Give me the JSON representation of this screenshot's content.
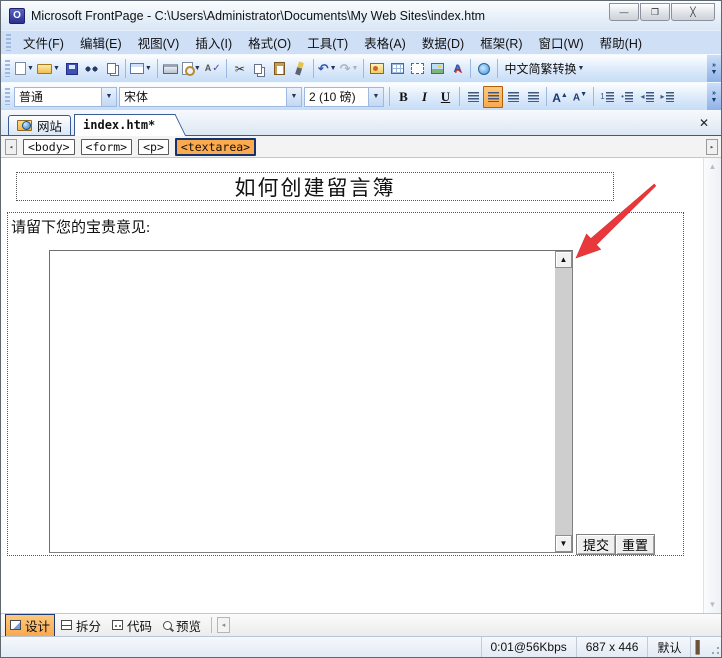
{
  "titlebar": {
    "title": "Microsoft FrontPage - C:\\Users\\Administrator\\Documents\\My Web Sites\\index.htm",
    "app_icon_letter": "O"
  },
  "window_controls": {
    "minimize": "—",
    "maximize": "❐",
    "close": "╳"
  },
  "menu": {
    "items": [
      "文件(F)",
      "编辑(E)",
      "视图(V)",
      "插入(I)",
      "格式(O)",
      "工具(T)",
      "表格(A)",
      "数据(D)",
      "框架(R)",
      "窗口(W)",
      "帮助(H)"
    ]
  },
  "toolbar_standard": {
    "icons": [
      "new-document",
      "open",
      "save",
      "find",
      "publish-site",
      "toggle-pane",
      "print",
      "print-preview",
      "spelling",
      "cut",
      "copy",
      "paste",
      "format-painter",
      "undo",
      "redo",
      "web-component",
      "insert-table",
      "insert-layer",
      "insert-picture",
      "insert-drawing",
      "hyperlink"
    ],
    "chinese_convert": "中文简繁转换",
    "spelling_glyph": "✓",
    "cut_glyph": "✂",
    "undo_glyph": "↶",
    "redo_glyph": "↷",
    "drawing_glyph": "A"
  },
  "formatting": {
    "style": "普通",
    "font": "宋体",
    "size": "2 (10 磅)",
    "bold": "B",
    "italic": "I",
    "underline": "U",
    "grow_font": "A",
    "shrink_font": "A",
    "active_button": "align-center"
  },
  "tabs": {
    "site": "网站",
    "page": "index.htm*",
    "close": "✕"
  },
  "tag_selector": {
    "tags": [
      "<body>",
      "<form>",
      "<p>",
      "<textarea>"
    ],
    "active_tag": "<textarea>"
  },
  "editor": {
    "title": "如何创建留言簿",
    "prompt": "请留下您的宝贵意见:",
    "textarea_value": "",
    "submit": "提交",
    "reset": "重置"
  },
  "annotation": {
    "arrow_color": "#e8383c",
    "arrow_points_to": "textarea-scrollbar-top"
  },
  "view_tabs": {
    "design": "设计",
    "split": "拆分",
    "code": "代码",
    "preview": "预览"
  },
  "status": {
    "time": "0:01@56Kbps",
    "size": "687 x 446",
    "theme": "默认"
  },
  "glyphs": {
    "dropdown": "▼",
    "overflow": "»",
    "up": "▲",
    "down": "▼",
    "left": "◂",
    "right": "▸"
  },
  "colors": {
    "highlight_orange": "#f9a94f",
    "selection_border": "#15316e",
    "toolbar_blue": "#c6dcf7",
    "menu_blue": "#cfdff6"
  }
}
